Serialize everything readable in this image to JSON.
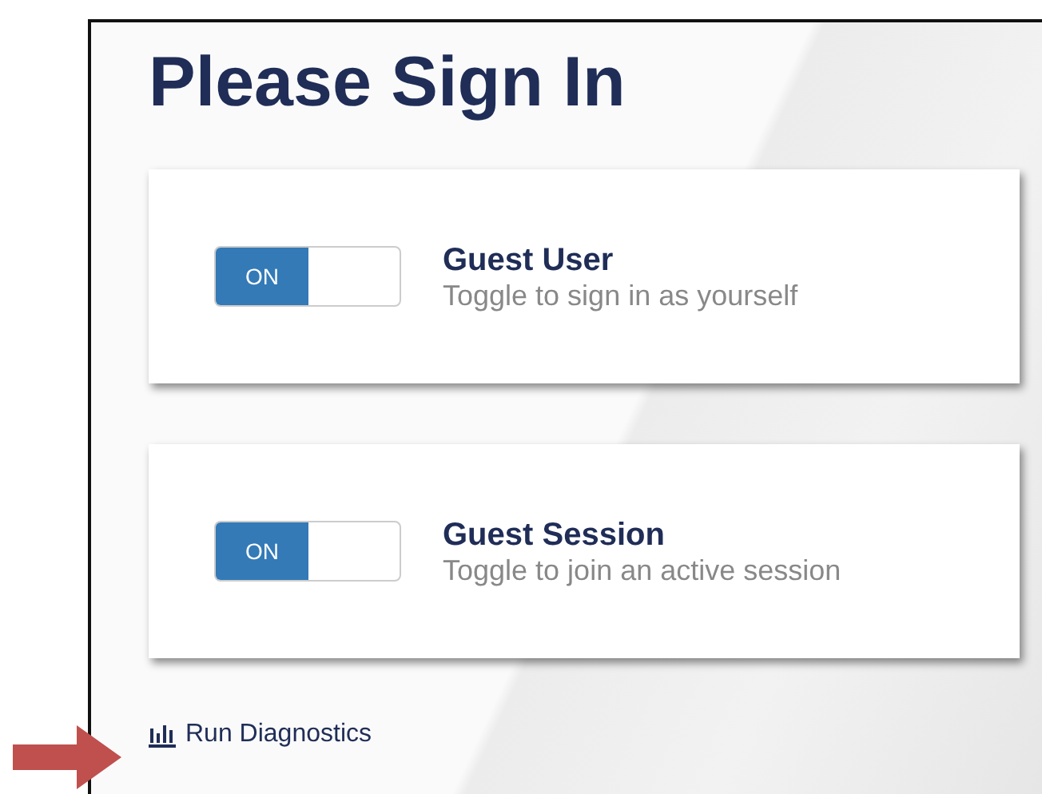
{
  "title": "Please Sign In",
  "options": [
    {
      "name": "Guest User",
      "description": "Toggle to sign in as yourself",
      "toggle_label": "ON",
      "on": true
    },
    {
      "name": "Guest Session",
      "description": "Toggle to join an active session",
      "toggle_label": "ON",
      "on": true
    }
  ],
  "diagnostics_link": "Run Diagnostics"
}
